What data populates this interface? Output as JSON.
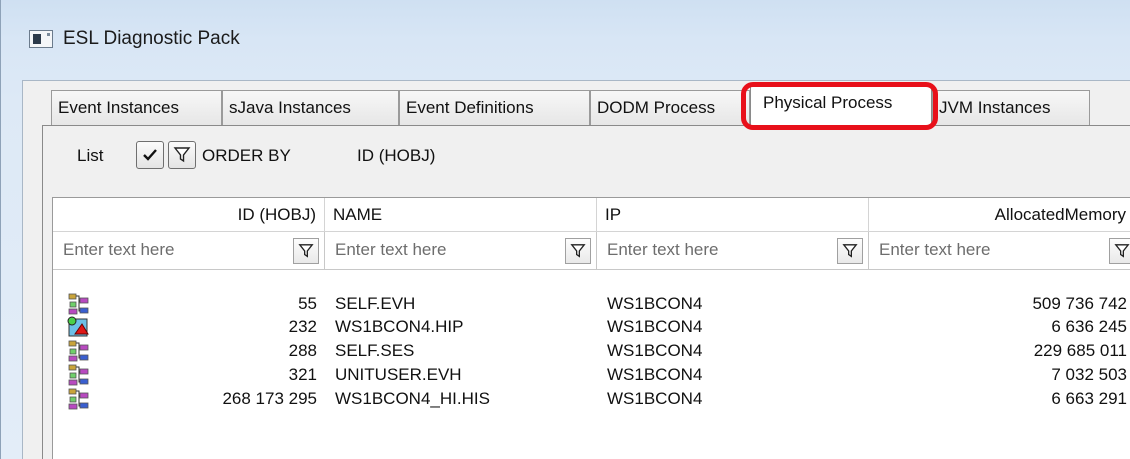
{
  "window": {
    "title": "ESL Diagnostic Pack"
  },
  "tabs": [
    {
      "label": "Event Instances",
      "active": false
    },
    {
      "label": "sJava Instances",
      "active": false
    },
    {
      "label": "Event Definitions",
      "active": false
    },
    {
      "label": "DODM Process",
      "active": false
    },
    {
      "label": "Physical Process",
      "active": true
    },
    {
      "label": "JVM Instances",
      "active": false
    }
  ],
  "highlight_color": "#e8101a",
  "toolbar": {
    "list_label": "List",
    "apply_icon": "check-icon",
    "filter_icon": "funnel-icon",
    "order_by_label": "ORDER BY",
    "order_by_value": "ID (HOBJ)"
  },
  "table": {
    "columns": [
      "ID (HOBJ)",
      "NAME",
      "IP",
      "AllocatedMemory"
    ],
    "filter_placeholder": "Enter text here",
    "rows": [
      {
        "icon": "process-tree-icon",
        "id": "55",
        "name": "SELF.EVH",
        "ip": "WS1BCON4",
        "memory": "509 736 742"
      },
      {
        "icon": "hip-process-icon",
        "id": "232",
        "name": "WS1BCON4.HIP",
        "ip": "WS1BCON4",
        "memory": "6 636 245"
      },
      {
        "icon": "process-tree-icon",
        "id": "288",
        "name": "SELF.SES",
        "ip": "WS1BCON4",
        "memory": "229 685 011"
      },
      {
        "icon": "process-tree-icon",
        "id": "321",
        "name": "UNITUSER.EVH",
        "ip": "WS1BCON4",
        "memory": "7 032 503"
      },
      {
        "icon": "process-tree-icon",
        "id": "268 173 295",
        "name": "WS1BCON4_HI.HIS",
        "ip": "WS1BCON4",
        "memory": "6 663 291"
      }
    ]
  }
}
